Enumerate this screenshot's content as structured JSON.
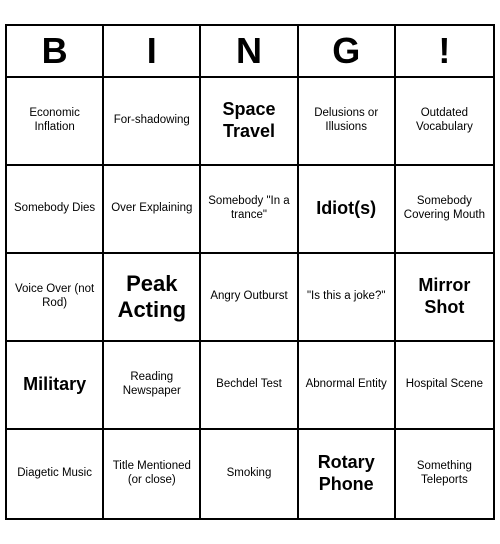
{
  "header": {
    "letters": [
      "B",
      "I",
      "N",
      "G",
      "!"
    ]
  },
  "cells": [
    {
      "text": "Economic Inflation",
      "size": "normal"
    },
    {
      "text": "For-shadowing",
      "size": "normal"
    },
    {
      "text": "Space Travel",
      "size": "large"
    },
    {
      "text": "Delusions or Illusions",
      "size": "normal"
    },
    {
      "text": "Outdated Vocabulary",
      "size": "normal"
    },
    {
      "text": "Somebody Dies",
      "size": "normal"
    },
    {
      "text": "Over Explaining",
      "size": "normal"
    },
    {
      "text": "Somebody \"In a trance\"",
      "size": "normal"
    },
    {
      "text": "Idiot(s)",
      "size": "large"
    },
    {
      "text": "Somebody Covering Mouth",
      "size": "normal"
    },
    {
      "text": "Voice Over (not Rod)",
      "size": "normal"
    },
    {
      "text": "Peak Acting",
      "size": "xl"
    },
    {
      "text": "Angry Outburst",
      "size": "normal"
    },
    {
      "text": "\"Is this a joke?\"",
      "size": "normal"
    },
    {
      "text": "Mirror Shot",
      "size": "large"
    },
    {
      "text": "Military",
      "size": "large"
    },
    {
      "text": "Reading Newspaper",
      "size": "normal"
    },
    {
      "text": "Bechdel Test",
      "size": "normal"
    },
    {
      "text": "Abnormal Entity",
      "size": "normal"
    },
    {
      "text": "Hospital Scene",
      "size": "normal"
    },
    {
      "text": "Diagetic Music",
      "size": "normal"
    },
    {
      "text": "Title Mentioned (or close)",
      "size": "normal"
    },
    {
      "text": "Smoking",
      "size": "normal"
    },
    {
      "text": "Rotary Phone",
      "size": "large"
    },
    {
      "text": "Something Teleports",
      "size": "normal"
    }
  ]
}
